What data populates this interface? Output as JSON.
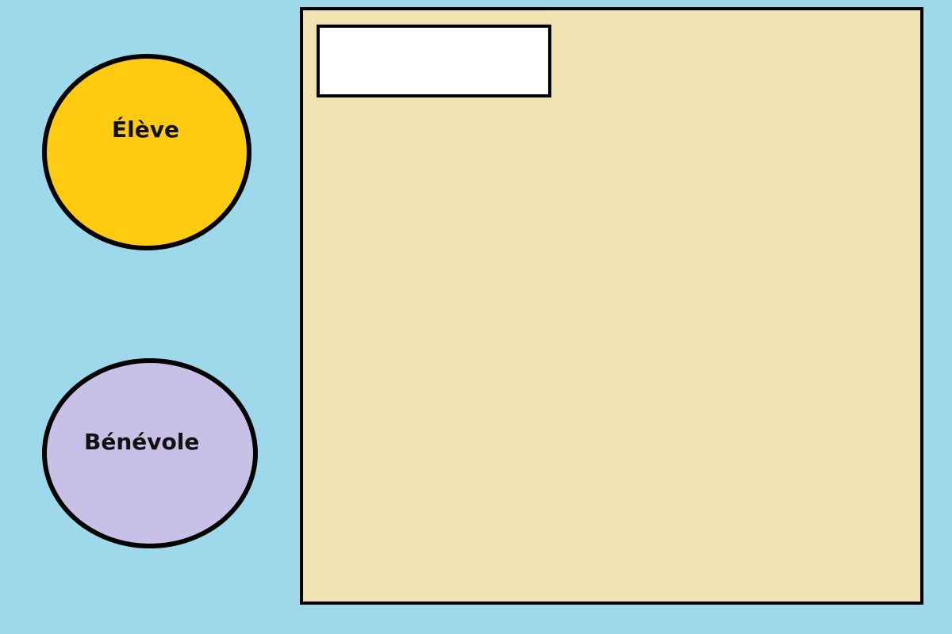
{
  "colors": {
    "background": "#9DD9EA",
    "eleve_fill": "#FECB10",
    "benevole_fill": "#C8C0E6",
    "panel_fill": "#EFE3B1",
    "input_fill": "#FFFFFF",
    "border": "#000000"
  },
  "roles": {
    "eleve": {
      "label": "Élève"
    },
    "benevole": {
      "label": "Bénévole"
    }
  },
  "panel": {
    "input": {
      "value": "",
      "placeholder": ""
    }
  }
}
